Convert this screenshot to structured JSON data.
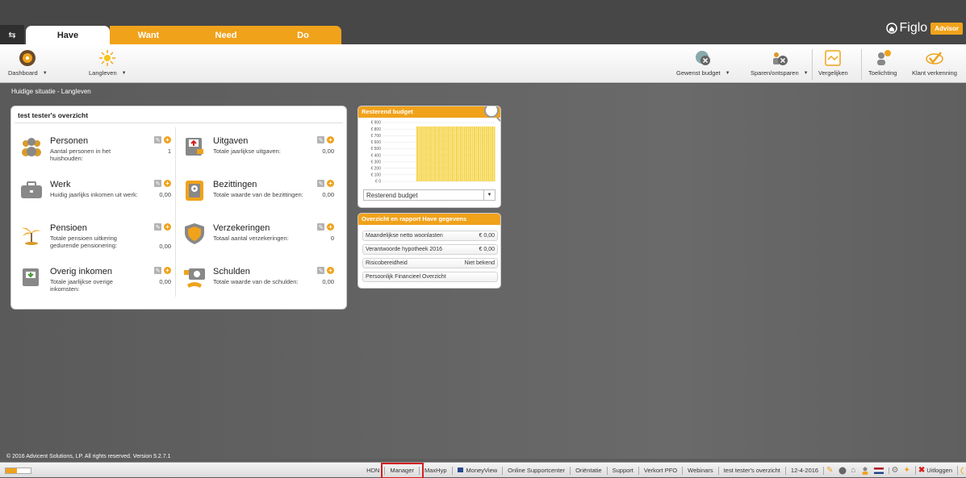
{
  "tabs": [
    {
      "label": "Have",
      "active": true
    },
    {
      "label": "Want",
      "active": false
    },
    {
      "label": "Need",
      "active": false
    },
    {
      "label": "Do",
      "active": false
    }
  ],
  "brand": {
    "name": "Figlo",
    "badge": "Advisor"
  },
  "toolbar": {
    "dashboard": "Dashboard",
    "langleven": "Langleven",
    "gewenst_budget": "Gewenst budget",
    "sparen": "Sparen/ontsparen",
    "vergelijken": "Vergelijken",
    "toelichting": "Toelichting",
    "klant": "Klant verkenning"
  },
  "breadcrumb": "Huidige situatie - Langleven",
  "overview": {
    "title": "test tester's overzicht",
    "left": [
      {
        "name": "Personen",
        "desc": "Aantal personen in het huishouden:",
        "value": "1",
        "icon": "people-icon"
      },
      {
        "name": "Werk",
        "desc": "Huidig jaarlijks inkomen uit werk:",
        "value": "0,00",
        "icon": "briefcase-icon"
      },
      {
        "name": "Pensioen",
        "desc": "Totale pensioen uitkering gedurende pensionering:",
        "value": "0,00",
        "icon": "palm-tree-icon"
      },
      {
        "name": "Overig inkomen",
        "desc": "Totale jaarlijkse overige inkomsten:",
        "value": "0,00",
        "icon": "wallet-in-icon"
      }
    ],
    "right": [
      {
        "name": "Uitgaven",
        "desc": "Totale jaarlijkse uitgaven:",
        "value": "0,00",
        "icon": "wallet-out-icon"
      },
      {
        "name": "Bezittingen",
        "desc": "Totale waarde van de bezittingen:",
        "value": "0,00",
        "icon": "safe-icon"
      },
      {
        "name": "Verzekeringen",
        "desc": "Totaal aantal verzekeringen:",
        "value": "0",
        "icon": "shield-icon"
      },
      {
        "name": "Schulden",
        "desc": "Totale waarde van de schulden:",
        "value": "0,00",
        "icon": "debt-icon"
      }
    ]
  },
  "budget_panel": {
    "title": "Resterend budget",
    "select": "Resterend budget"
  },
  "chart_data": {
    "type": "bar",
    "ytick_labels": [
      "€ 900",
      "€ 800",
      "€ 700",
      "€ 600",
      "€ 500",
      "€ 400",
      "€ 300",
      "€ 200",
      "€ 100",
      "€ 0"
    ],
    "ylim": [
      0,
      900
    ],
    "bar_count": 40,
    "values_range_start": 840,
    "color": "#f5d54a"
  },
  "report_panel": {
    "title": "Overzicht en rapport Have gegevens",
    "rows": [
      {
        "label": "Maandelijkse netto woonlasten",
        "value": "€ 0,00"
      },
      {
        "label": "Verantwoorde hypotheek 2016",
        "value": "€ 0,00"
      },
      {
        "label": "Risicobereidheid",
        "value": "Niet bekend"
      },
      {
        "label": "Persoonlijk Financieel Overzicht",
        "value": ""
      }
    ]
  },
  "copyright": "© 2016 Advicent Solutions, LP. All rights reserved. Version 5.2.7.1",
  "footer": {
    "progress": 0.45,
    "links": [
      "HDN",
      "Manager",
      "MaxHyp",
      "MoneyView",
      "Online Supportcenter",
      "Oriëntatie",
      "Support",
      "Verkort PFO",
      "Webinars",
      "test tester's overzicht",
      "12-4-2016"
    ],
    "logout": "Uitloggen"
  },
  "colors": {
    "accent": "#f0a21b",
    "dark": "#474747"
  }
}
